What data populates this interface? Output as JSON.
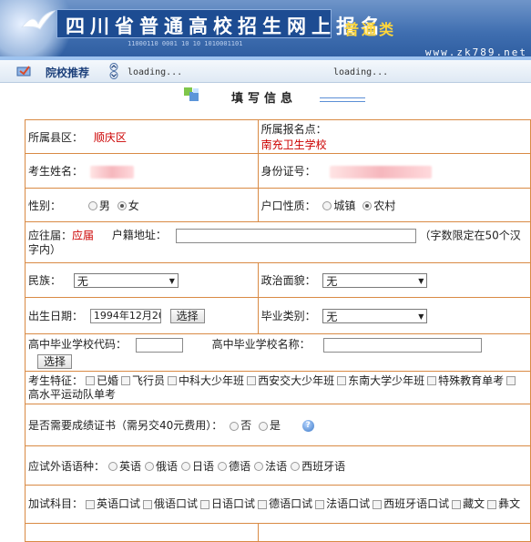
{
  "banner": {
    "title": "四川省普通高校招生网上报名",
    "tag": "普通类",
    "url": "www.zk789.net",
    "binary": "11000110  0001  10 10  1010001101"
  },
  "nav": {
    "title": "院校推荐",
    "loading1": "loading...",
    "loading2": "loading..."
  },
  "section": {
    "title": "填写信息"
  },
  "form": {
    "county_label": "所属县区：",
    "county_value": "顺庆区",
    "site_label": "所属报名点：",
    "site_value": "南充卫生学校",
    "name_label": "考生姓名：",
    "id_label": "身份证号：",
    "gender_label": "性别：",
    "gender_options": [
      "男",
      "女"
    ],
    "hukou_label": "户口性质：",
    "hukou_options": [
      "城镇",
      "农村"
    ],
    "grad_label": "应往届：",
    "grad_value": "应届",
    "address_label": "户籍地址：",
    "address_hint": "（字数限定在50个汉字内）",
    "ethnicity_label": "民族：",
    "ethnicity_value": "无",
    "political_label": "政治面貌：",
    "political_value": "无",
    "birth_label": "出生日期：",
    "birth_value": "1994年12月20",
    "select_button": "选择",
    "gradtype_label": "毕业类别：",
    "gradtype_value": "无",
    "school_code_label": "高中毕业学校代码：",
    "school_name_label": "高中毕业学校名称：",
    "traits_label": "考生特征：",
    "traits": [
      "已婚",
      "飞行员",
      "中科大少年班",
      "西安交大少年班",
      "东南大学少年班",
      "特殊教育单考",
      "高水平运动队单考"
    ],
    "cert_label": "是否需要成绩证书（需另交40元费用）：",
    "cert_options": [
      "否",
      "是"
    ],
    "lang_label": "应试外语语种：",
    "lang_options": [
      "英语",
      "俄语",
      "日语",
      "德语",
      "法语",
      "西班牙语"
    ],
    "extra_label": "加试科目：",
    "extra_options": [
      "英语口试",
      "俄语口试",
      "日语口试",
      "德语口试",
      "法语口试",
      "西班牙语口试",
      "藏文",
      "彝文"
    ]
  }
}
